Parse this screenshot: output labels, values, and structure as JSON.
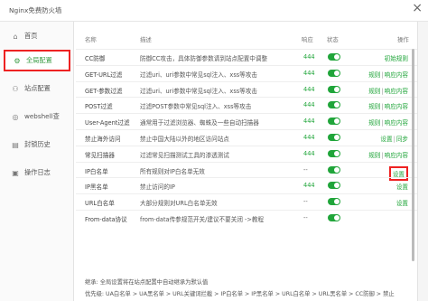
{
  "window": {
    "title": "Nginx免费防火墙"
  },
  "sidebar": {
    "items": [
      {
        "label": "首页",
        "icon": "home-icon",
        "glyph": "⌂"
      },
      {
        "label": "全局配置",
        "icon": "settings-icon",
        "glyph": "⚙"
      },
      {
        "label": "站点配置",
        "icon": "site-icon",
        "glyph": "⚇"
      },
      {
        "label": "webshell查",
        "icon": "scan-icon",
        "glyph": "◎"
      },
      {
        "label": "封锁历史",
        "icon": "history-icon",
        "glyph": "▤"
      },
      {
        "label": "操作日志",
        "icon": "log-icon",
        "glyph": "▣"
      }
    ]
  },
  "table": {
    "headers": {
      "name": "名称",
      "desc": "描述",
      "resp": "响应",
      "status": "状态",
      "op": "操作"
    },
    "rows": [
      {
        "name": "CC防御",
        "desc": "防御CC攻击，具体防御参数请到站点配置中调整",
        "resp": "444",
        "toggle": true,
        "ops": [
          "初始规则"
        ]
      },
      {
        "name": "GET-URL过滤",
        "desc": "过滤uri、uri参数中常见sql注入、xss等攻击",
        "resp": "444",
        "toggle": true,
        "ops": [
          "规则",
          "响应内容"
        ]
      },
      {
        "name": "GET-参数过滤",
        "desc": "过滤uri、uri参数中常见sql注入、xss等攻击",
        "resp": "444",
        "toggle": true,
        "ops": [
          "规则",
          "响应内容"
        ]
      },
      {
        "name": "POST过滤",
        "desc": "过滤POST参数中常见sql注入、xss等攻击",
        "resp": "444",
        "toggle": true,
        "ops": [
          "规则",
          "响应内容"
        ]
      },
      {
        "name": "User-Agent过滤",
        "desc": "通常用于过滤浏览器、蜘蛛及一些自动扫描器",
        "resp": "444",
        "toggle": true,
        "ops": [
          "规则",
          "响应内容"
        ]
      },
      {
        "name": "禁止海外访问",
        "desc": "禁止中国大陆以外的地区访问站点",
        "resp": "444",
        "toggle": true,
        "ops": [
          "设置",
          "同步"
        ]
      },
      {
        "name": "常见扫描器",
        "desc": "过滤常见扫描测试工具的渗透测试",
        "resp": "444",
        "toggle": true,
        "ops": [
          "规则",
          "响应内容"
        ]
      },
      {
        "name": "IP白名单",
        "desc": "所有规则对IP白名单无效",
        "resp": "--",
        "toggle": true,
        "ops": [
          "设置"
        ],
        "boxed": true
      },
      {
        "name": "IP黑名单",
        "desc": "禁止访问的IP",
        "resp": "444",
        "toggle": true,
        "ops": [
          "设置"
        ]
      },
      {
        "name": "URL白名单",
        "desc": "大部分规则对URL白名单无效",
        "resp": "--",
        "toggle": true,
        "ops": [
          "设置"
        ]
      },
      {
        "name": "From-data协议",
        "desc": "from-data传参规范开关/建议不要关闭 ->教程",
        "resp": "--",
        "toggle": true,
        "ops": []
      }
    ]
  },
  "notes": {
    "line1": "继承: 全局设置将在站点配置中自动继承为默认值",
    "line2": "优先级: UA白名单 > UA黑名单 > URL关键词拦截 > IP白名单 > IP黑名单 > URL白名单 > URL黑名单 > CC防御 > 禁止"
  },
  "colors": {
    "accent": "#20a53a",
    "highlight": "#e22222"
  }
}
